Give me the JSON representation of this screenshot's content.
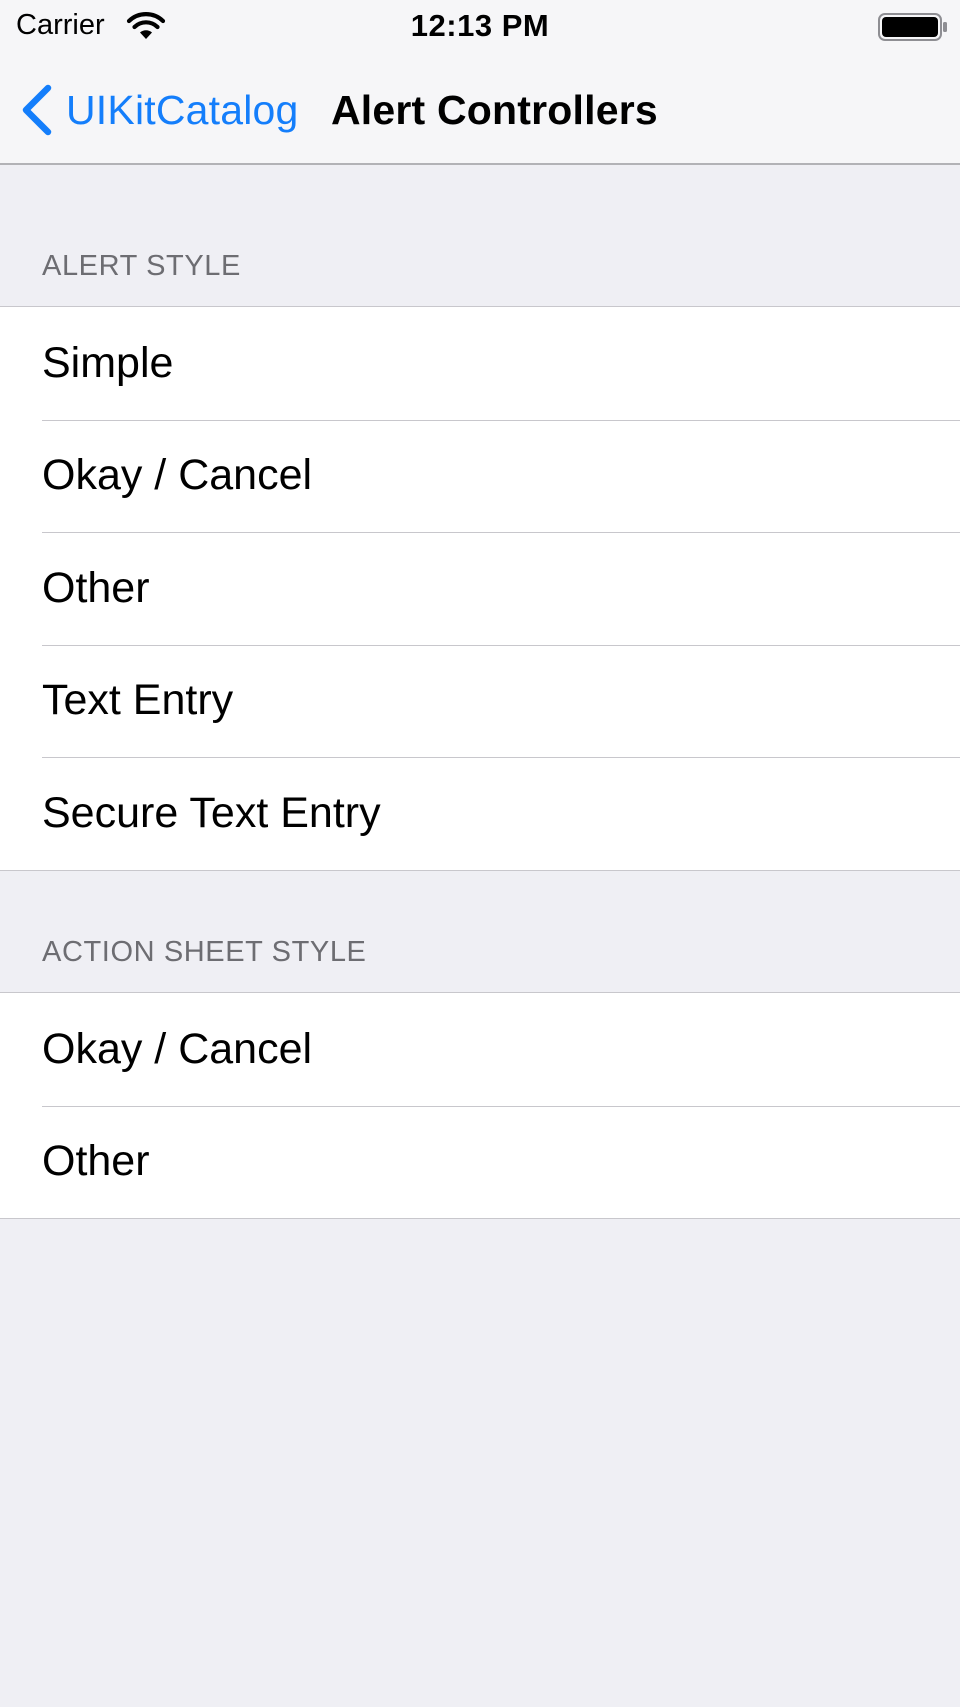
{
  "status_bar": {
    "carrier": "Carrier",
    "time": "12:13 PM",
    "wifi_icon": "wifi-icon",
    "battery_icon": "battery-icon"
  },
  "nav": {
    "back_label": "UIKitCatalog",
    "back_icon": "chevron-left-icon",
    "title": "Alert Controllers",
    "accent_color": "#147efb"
  },
  "sections": [
    {
      "header": "ALERT STYLE",
      "items": [
        "Simple",
        "Okay / Cancel",
        "Other",
        "Text Entry",
        "Secure Text Entry"
      ]
    },
    {
      "header": "ACTION SHEET STYLE",
      "items": [
        "Okay / Cancel",
        "Other"
      ]
    }
  ],
  "colors": {
    "background": "#efeff4",
    "cell": "#ffffff",
    "separator": "#c8c7cc",
    "section_header_text": "#6d6d72"
  }
}
